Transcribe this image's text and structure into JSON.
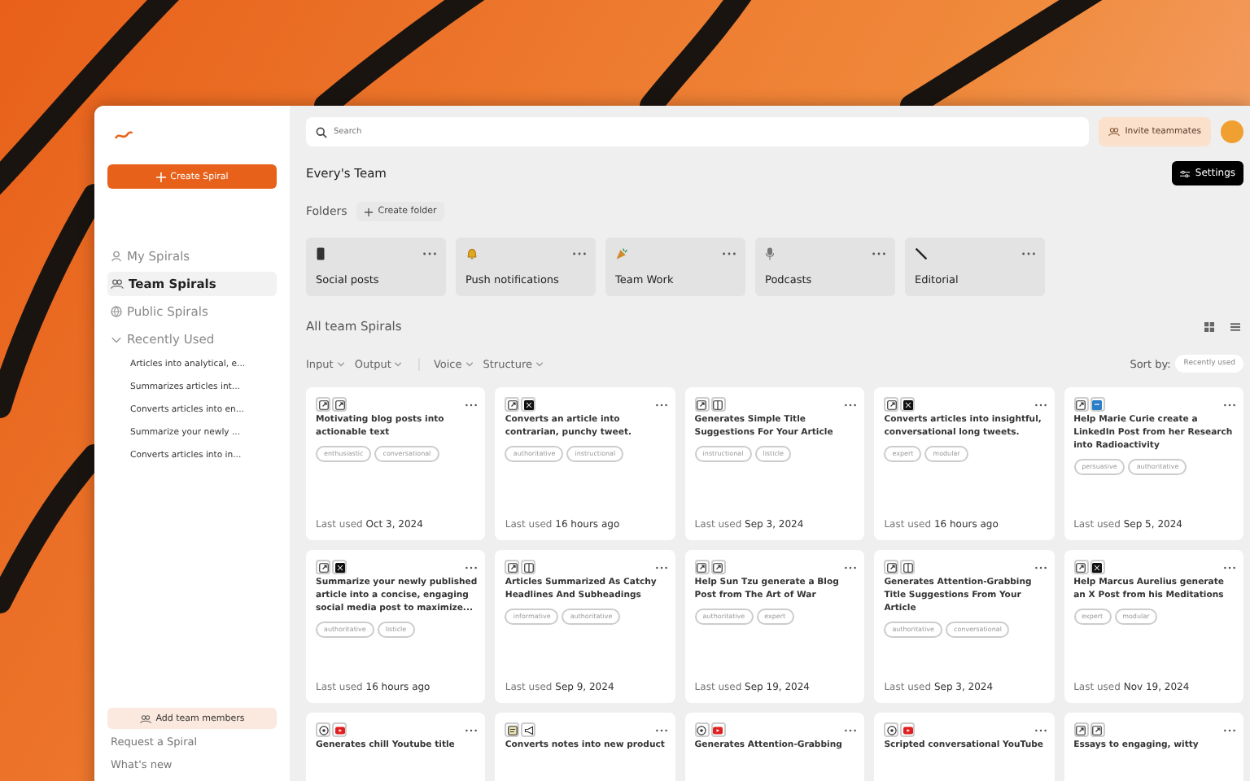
{
  "sidebar": {
    "create_button": "Create Spiral",
    "nav": [
      {
        "label": "My Spirals",
        "selected": false
      },
      {
        "label": "Team Spirals",
        "selected": true
      },
      {
        "label": "Public Spirals",
        "selected": false
      },
      {
        "label": "Recently Used",
        "selected": false,
        "expanded": true,
        "children": [
          "Articles into analytical, e...",
          "Summarizes articles int...",
          "Converts articles into en...",
          "Summarize your newly ...",
          "Converts articles into in..."
        ]
      }
    ],
    "add_members": "Add team members",
    "links": [
      "Request a Spiral",
      "What's new"
    ]
  },
  "search": {
    "placeholder": "Search"
  },
  "invite_button": "Invite teammates",
  "team_title": "Every's Team",
  "settings_button": "Settings",
  "folders_label": "Folders",
  "create_folder": "Create folder",
  "folders": [
    {
      "name": "Social posts"
    },
    {
      "name": "Push notifications"
    },
    {
      "name": "Team Work"
    },
    {
      "name": "Podcasts"
    },
    {
      "name": "Editorial"
    }
  ],
  "section_title": "All team Spirals",
  "filters": [
    [
      "Input",
      "Output"
    ],
    [
      "Voice",
      "Structure"
    ]
  ],
  "sort_label": "Sort by:",
  "sort_value": "Recently used",
  "cards": [
    {
      "title": "Motivating blog posts into actionable text",
      "tags": [
        "enthusiastic",
        "conversational"
      ],
      "used_label": "Last used",
      "used": "Oct 3, 2024"
    },
    {
      "title": "Converts an article into contrarian, punchy tweet.",
      "tags": [
        "authoritative",
        "instructional"
      ],
      "used_label": "Last used",
      "used": "16 hours ago"
    },
    {
      "title": "Generates Simple Title Suggestions For Your Article",
      "tags": [
        "instructional",
        "listicle"
      ],
      "used_label": "Last used",
      "used": "Sep 3, 2024"
    },
    {
      "title": "Converts articles into insightful, conversational long tweets.",
      "tags": [
        "expert",
        "modular"
      ],
      "used_label": "Last used",
      "used": "16 hours ago"
    },
    {
      "title": "Help Marie Curie create a LinkedIn Post from her Research into Radioactivity",
      "tags": [
        "persuasive",
        "authoritative"
      ],
      "used_label": "Last used",
      "used": "Sep 5, 2024"
    },
    {
      "title": "Summarize your newly published article into a concise, engaging social media post to maximize...",
      "tags": [
        "authoritative",
        "listicle"
      ],
      "used_label": "Last used",
      "used": "16 hours ago"
    },
    {
      "title": "Articles Summarized As Catchy Headlines And Subheadings",
      "tags": [
        "informative",
        "authoritative"
      ],
      "used_label": "Last used",
      "used": "Sep 9, 2024"
    },
    {
      "title": "Help Sun Tzu generate a Blog Post from The Art of War",
      "tags": [
        "authoritative",
        "expert"
      ],
      "used_label": "Last used",
      "used": "Sep 19, 2024"
    },
    {
      "title": "Generates Attention-Grabbing Title Suggestions From Your Article",
      "tags": [
        "authoritative",
        "conversational"
      ],
      "used_label": "Last used",
      "used": "Sep 3, 2024"
    },
    {
      "title": "Help Marcus Aurelius generate an X Post from his Meditations",
      "tags": [
        "expert",
        "modular"
      ],
      "used_label": "Last used",
      "used": "Nov 19, 2024"
    },
    {
      "title": "Generates chill Youtube title"
    },
    {
      "title": "Converts notes into new product"
    },
    {
      "title": "Generates Attention-Grabbing"
    },
    {
      "title": "Scripted conversational YouTube"
    },
    {
      "title": "Essays to engaging, witty"
    }
  ]
}
